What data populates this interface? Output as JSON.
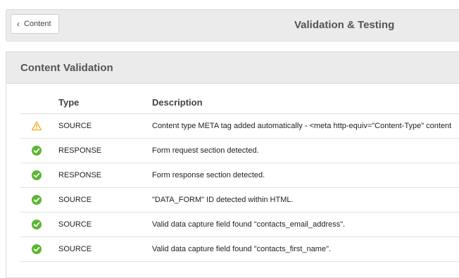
{
  "header": {
    "back_label": "Content",
    "title": "Validation & Testing"
  },
  "panel": {
    "title": "Content Validation"
  },
  "table": {
    "columns": {
      "type": "Type",
      "description": "Description"
    },
    "rows": [
      {
        "status": "warning",
        "type": "SOURCE",
        "description": "Content type META tag added automatically - <meta http-equiv=\"Content-Type\" content"
      },
      {
        "status": "ok",
        "type": "RESPONSE",
        "description": "Form request section detected."
      },
      {
        "status": "ok",
        "type": "RESPONSE",
        "description": "Form response section detected."
      },
      {
        "status": "ok",
        "type": "SOURCE",
        "description": "\"DATA_FORM\" ID detected within HTML."
      },
      {
        "status": "ok",
        "type": "SOURCE",
        "description": "Valid data capture field found \"contacts_email_address\"."
      },
      {
        "status": "ok",
        "type": "SOURCE",
        "description": "Valid data capture field found \"contacts_first_name\"."
      }
    ]
  },
  "colors": {
    "ok": "#5cb533",
    "warning": "#f0ad1e"
  },
  "icons": {
    "ok": "check-circle-icon",
    "warning": "warning-triangle-icon",
    "back": "chevron-left-icon"
  }
}
